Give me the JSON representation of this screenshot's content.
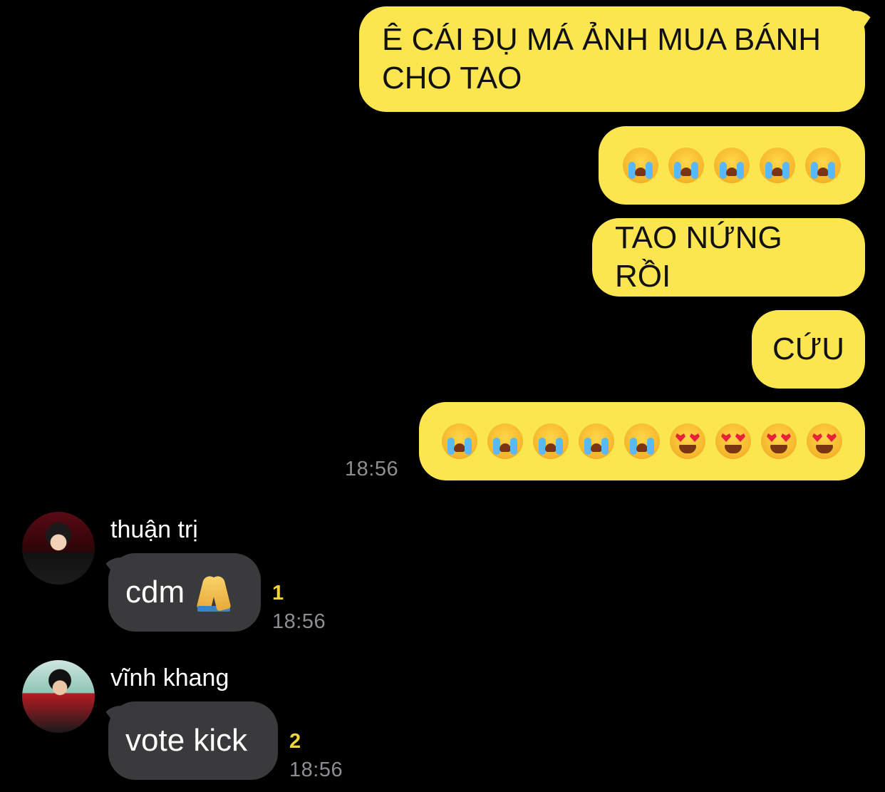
{
  "colors": {
    "background": "#000000",
    "outgoing_bubble": "#fbe64f",
    "incoming_bubble": "#3a3a3c",
    "timestamp": "#8d8d92",
    "read_count": "#f1d43c"
  },
  "outgoing": {
    "msg1": "Ê CÁI ĐỤ MÁ ẢNH MUA BÁNH CHO TAO",
    "msg2_emojis": [
      "loudly-crying-face",
      "loudly-crying-face",
      "loudly-crying-face",
      "loudly-crying-face",
      "loudly-crying-face"
    ],
    "msg3": "TAO NỨNG RỒI",
    "msg4": "CỨU",
    "msg5_emojis": [
      "loudly-crying-face",
      "loudly-crying-face",
      "loudly-crying-face",
      "loudly-crying-face",
      "loudly-crying-face",
      "heart-eyes-face",
      "heart-eyes-face",
      "heart-eyes-face",
      "heart-eyes-face"
    ],
    "time": "18:56"
  },
  "incoming": [
    {
      "sender": "thuận trị",
      "text": "cdm",
      "emoji": "folded-hands",
      "read_count": "1",
      "time": "18:56"
    },
    {
      "sender": "vĩnh khang",
      "text": "vote kick",
      "read_count": "2",
      "time": "18:56"
    }
  ]
}
